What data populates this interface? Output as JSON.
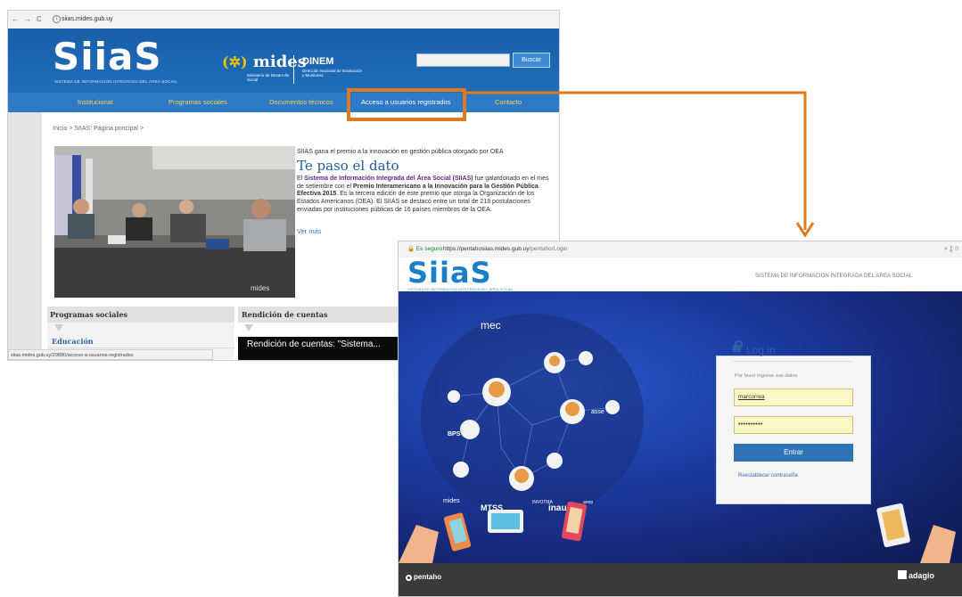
{
  "portal": {
    "url": "siias.mides.gub.uy",
    "logo": "SiiaS",
    "logo_subtitle": "SISTEMA DE INFORMACIÓN INTEGRADA DEL ÁREA SOCIAL",
    "mides": "mides",
    "mides_subtitle": "Ministerio de Desarrollo Social",
    "dinem": "DINEM",
    "dinem_subtitle": "Dirección Nacional de Evaluación y Monitoreo",
    "search_button": "Buscar",
    "menu": [
      "Institucional",
      "Programas sociales",
      "Documentos técnicos",
      "Acceso a usuarios registrados",
      "Contacto"
    ],
    "breadcrumb": "Inicio > SIIAS: Página principal >",
    "news": {
      "kicker": "SIIAS gana el premio a la innovación en gestión pública otorgado por OEA",
      "title": "Te paso el dato",
      "body_1": "El ",
      "body_hl": "Sistema de Información Integrada del Área Social (SIIAS)",
      "body_2": " fue galardonado en el mes de setiembre con el ",
      "body_b": "Premio Interamericano a la Innovación para la Gestión Pública Efectiva 2015",
      "body_3": ". Es la tercera edición de este premio que otorga la Organización de los Estados Americanos (OEA). El SIIAS se destacó entre un total de 218 postulaciones enviadas por instituciones públicas de 16 países miembros de la OEA.",
      "more": "Ver más"
    },
    "photo_watermark": "mides",
    "programs_title": "Programas sociales",
    "education": "Educación",
    "accountability_title": "Rendición de cuentas",
    "video_title": "Rendición de cuentas: \"Sistema...",
    "status_bar": "siias.mides.gub.uy/29880/acceso-a-usuarios-registrados"
  },
  "login_page": {
    "secure": "Es seguro",
    "url_main": "https://pentahosiias.mides.gub.uy",
    "url_path": "/pentaho/Login",
    "logo": "SiiaS",
    "logo_subtitle": "SISTEMA DE INFORMACIÓN INTEGRADA DEL ÁREA SOCIAL",
    "header_title": "SISTEMA DE INFORMACION INTEGRADA DEL AREA SOCIAL",
    "login_title": "Log in",
    "hint": "Por favor ingrese sus datos",
    "username": "marcorrea",
    "password": "••••••••••",
    "enter_button": "Entrar",
    "reset_link": "Reestablecer contraseña",
    "footer_left": "pentaho",
    "footer_right": "adagio",
    "network_labels": [
      "mec",
      "MTSS",
      "inau",
      "mides",
      "asse",
      "BPS",
      "INVOTMA",
      "anep"
    ]
  },
  "colors": {
    "highlight": "#e07a1c",
    "portal_header": "#1e6dbb",
    "login_button": "#2f73b6"
  }
}
